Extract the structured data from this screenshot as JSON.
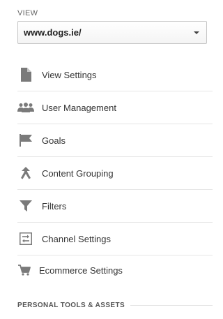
{
  "view": {
    "section_label": "VIEW",
    "selected": "www.dogs.ie/"
  },
  "menu": {
    "items": [
      {
        "label": "View Settings",
        "icon": "document-icon"
      },
      {
        "label": "User Management",
        "icon": "users-icon"
      },
      {
        "label": "Goals",
        "icon": "flag-icon"
      },
      {
        "label": "Content Grouping",
        "icon": "merge-arrow-icon"
      },
      {
        "label": "Filters",
        "icon": "funnel-icon"
      },
      {
        "label": "Channel Settings",
        "icon": "channel-arrows-icon"
      },
      {
        "label": "Ecommerce Settings",
        "icon": "cart-icon"
      }
    ]
  },
  "footer": {
    "section_title": "PERSONAL TOOLS & ASSETS"
  },
  "colors": {
    "icon_gray": "#7a7a7a",
    "text": "#333333",
    "divider": "#e6e6e6"
  }
}
